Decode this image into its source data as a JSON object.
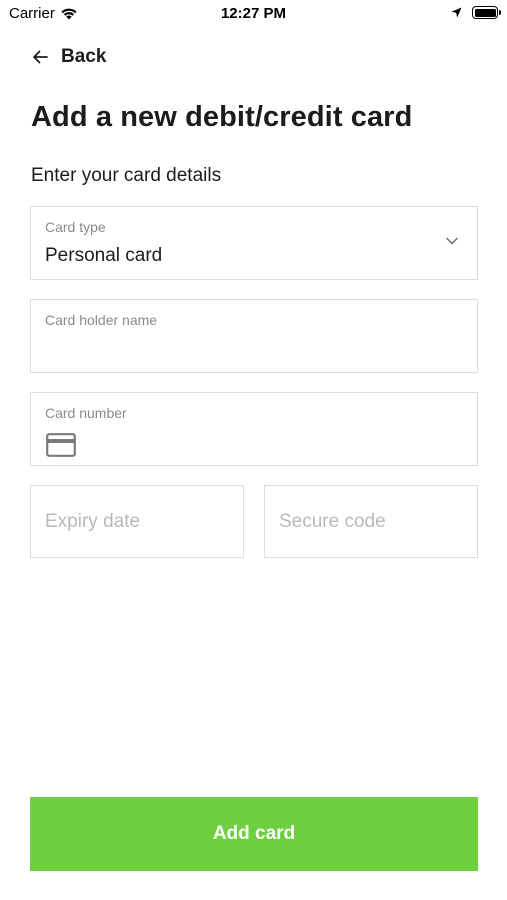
{
  "status_bar": {
    "carrier": "Carrier",
    "time": "12:27 PM",
    "icons": [
      "wifi-icon",
      "location-arrow-icon",
      "battery-icon"
    ]
  },
  "nav": {
    "back_label": "Back",
    "back_icon": "arrow-left-icon"
  },
  "page": {
    "title": "Add a new debit/credit card",
    "subtitle": "Enter your card details"
  },
  "form": {
    "card_type": {
      "label": "Card type",
      "value": "Personal card",
      "icon": "chevron-down-icon"
    },
    "card_holder": {
      "label": "Card holder name",
      "value": ""
    },
    "card_number": {
      "label": "Card number",
      "value": "",
      "icon": "credit-card-icon"
    },
    "expiry": {
      "placeholder": "Expiry date"
    },
    "secure_code": {
      "placeholder": "Secure code"
    }
  },
  "actions": {
    "add_card_label": "Add card"
  },
  "colors": {
    "accent_green": "#6ecf3f",
    "text_primary": "#1c1c1c",
    "text_muted": "#8a8a8a",
    "placeholder": "#b9b9b9",
    "border": "#dcdcdc"
  }
}
